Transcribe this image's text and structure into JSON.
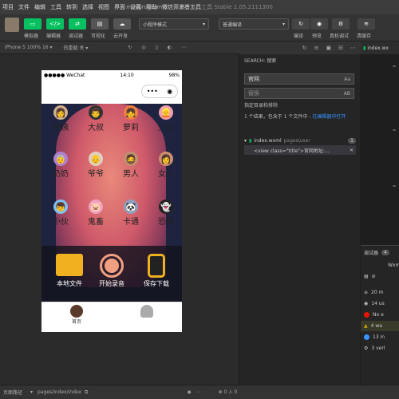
{
  "menubar": {
    "items": [
      "项目",
      "文件",
      "编辑",
      "工具",
      "转到",
      "选择",
      "视图",
      "界面",
      "设置",
      "帮助",
      "微信开发者工具"
    ],
    "title": "miniprogram-1",
    "subtitle": " - 微信开发者工具 Stable 1.05.2111300"
  },
  "toolbar": {
    "buttons": [
      "模拟器",
      "编辑器",
      "调试器",
      "可视化",
      "云开发"
    ],
    "mode_select": "小程序模式",
    "compile_select": "普通编译",
    "right_labels": [
      "编译",
      "预览",
      "真机调试",
      "清缓存"
    ]
  },
  "simbar": {
    "device": "iPhone 5 100% 16 ▾",
    "hotreload": "热重载 关 ▾"
  },
  "phone": {
    "carrier": "●●●●● WeChat",
    "time": "14:10",
    "battery": "98%",
    "voices_row1": [
      "阿姨",
      "大叔",
      "萝莉",
      "少女"
    ],
    "voices_row2": [
      "奶奶",
      "爷爷",
      "男人",
      "女人"
    ],
    "voices_row3": [
      "小伙",
      "鬼畜",
      "卡通",
      "恐怖"
    ],
    "actions": [
      "本地文件",
      "开始录音",
      "保存下载"
    ],
    "tabs": [
      "首页",
      ""
    ]
  },
  "search": {
    "header": "SEARCH: 搜索",
    "query": "官网",
    "replace_placeholder": "替换",
    "replace_suffix": "AB",
    "case_label": "Aa",
    "scope": "指定目录和排除",
    "result_summary": "1 个结果，包含于 1 个文件中 - ",
    "open_in_editor": "在编辑器中打开",
    "file": "index.wxml",
    "file_path": "pages\\user",
    "file_count": "1",
    "match_line": "<view class=\"title\">官网地址:..."
  },
  "editor": {
    "tab": "index.wx"
  },
  "debugger": {
    "title": "调试器",
    "badge": "4",
    "wxml_tab": "Wxm",
    "rows": [
      "20 m",
      "14 us",
      "No e",
      "4 wa",
      "13 in",
      "3 verl"
    ]
  },
  "footer": {
    "path_label": "页面路径",
    "path": "pages/index/index",
    "errors": "⊗ 0 ⚠ 0"
  },
  "colors": {
    "accent_green": "#07c160",
    "error_red": "#e51400",
    "warning_yellow": "#cca700",
    "info_blue": "#3794ff"
  }
}
